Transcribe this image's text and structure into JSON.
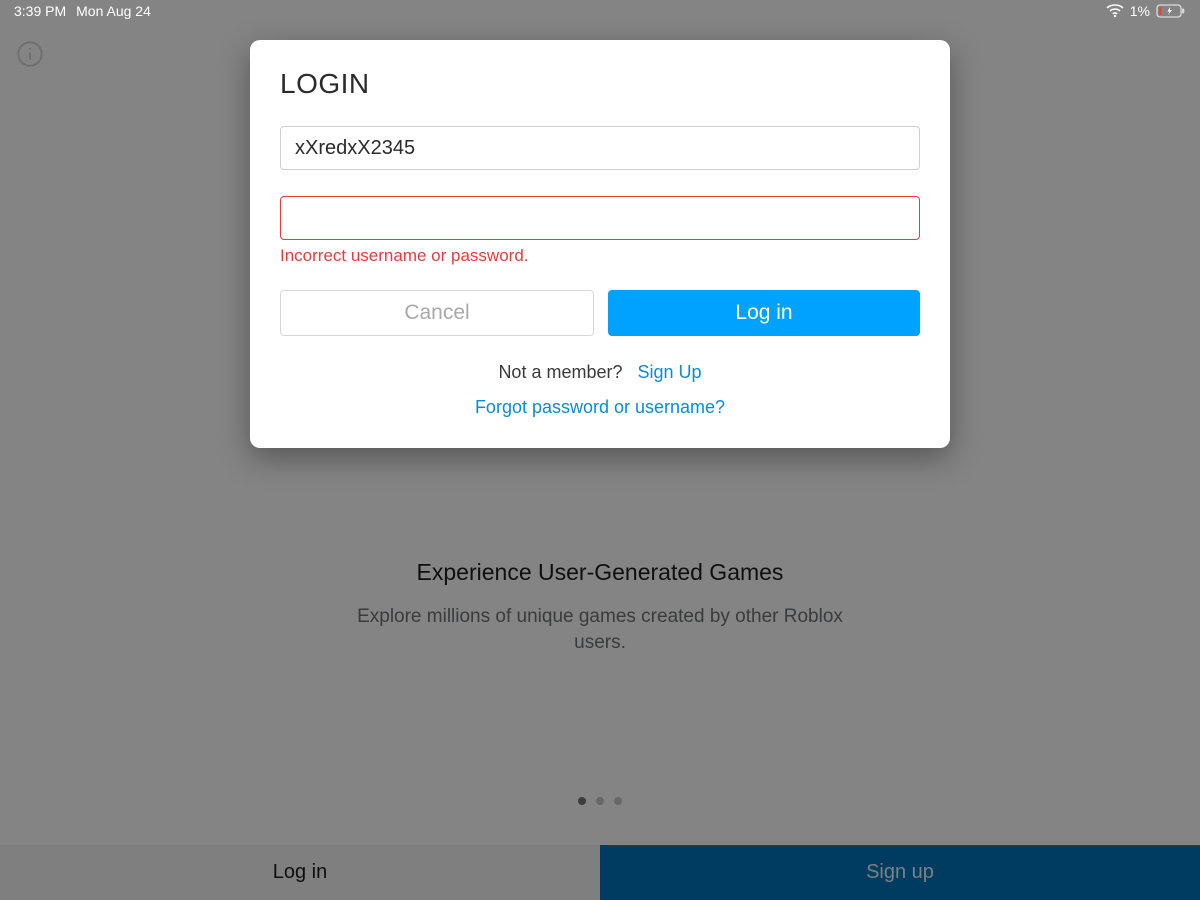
{
  "status": {
    "time": "3:39 PM",
    "date": "Mon Aug 24",
    "battery_pct": "1%"
  },
  "onboard": {
    "title": "Experience User-Generated Games",
    "subtitle": "Explore millions of unique games created by other Roblox users."
  },
  "bottom": {
    "login": "Log in",
    "signup": "Sign up"
  },
  "modal": {
    "title": "LOGIN",
    "username_value": "xXredxX2345",
    "password_value": "",
    "error": "Incorrect username or password.",
    "cancel": "Cancel",
    "login": "Log in",
    "not_member": "Not a member?",
    "sign_up": "Sign Up",
    "forgot": "Forgot password or username?"
  }
}
